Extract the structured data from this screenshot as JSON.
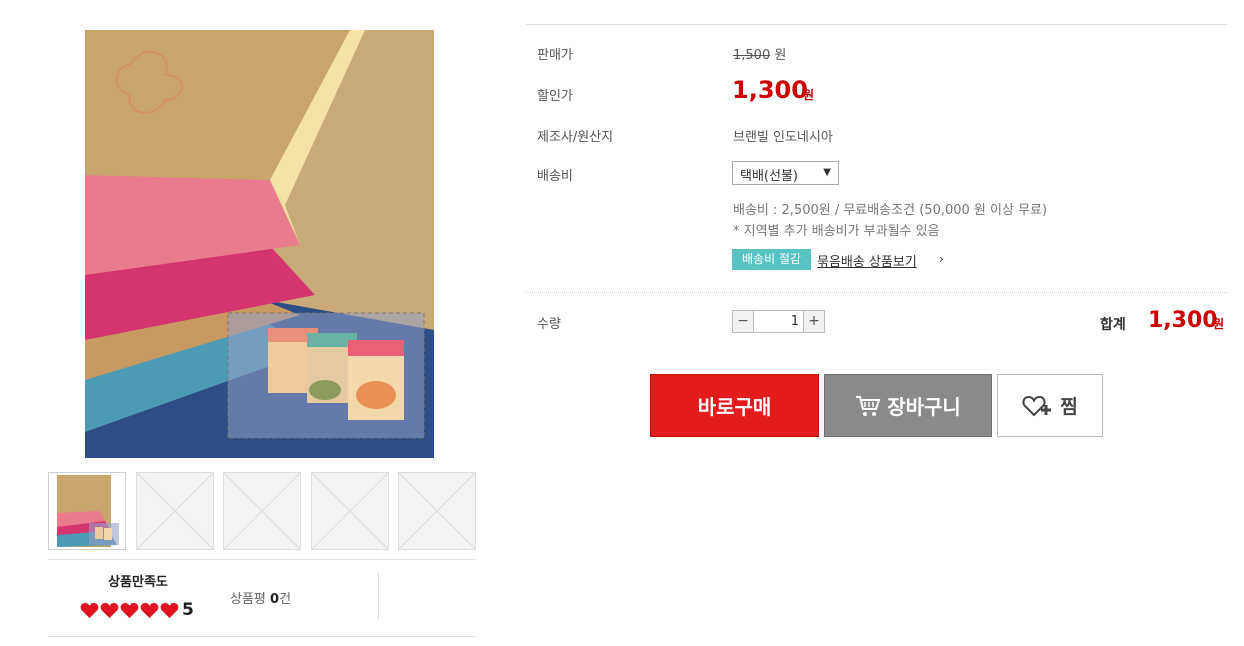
{
  "product": {
    "price_label": "판매가",
    "original_price": "1,500",
    "original_unit": "원",
    "sale_label": "할인가",
    "sale_price": "1,300",
    "sale_unit": "원",
    "maker_label": "제조사/원산지",
    "maker_value": "브랜빌 인도네시아",
    "shipping_label": "배송비",
    "shipping_option": "택배(선불)",
    "shipping_note1": "배송비 : 2,500원 / 무료배송조건 (50,000 원 이상 무료)",
    "shipping_note2": "* 지역별 추가 배송비가 부과될수 있음",
    "badge": "배송비 절감",
    "bundle_link": "묶음배송 상품보기",
    "bundle_arrow": "›",
    "qty_label": "수량",
    "qty_value": "1",
    "qty_minus": "−",
    "qty_plus": "+",
    "total_label": "합계",
    "total_price": "1,300",
    "total_unit": "원"
  },
  "buttons": {
    "buy": "바로구매",
    "cart": "장바구니",
    "wish": "찜"
  },
  "review": {
    "satisfaction_title": "상품만족도",
    "satisfaction_score": "5",
    "hearts_filled": 5,
    "review_label": "상품평",
    "review_count": "0",
    "review_unit": "건"
  },
  "thumbnails": {
    "count": 5,
    "active_index": 0
  },
  "colors": {
    "accent_red": "#cc0000",
    "buy_red": "#e21b1b",
    "cart_gray": "#8a8a8a",
    "badge_teal": "#58c3c3"
  },
  "icons": [
    "cart-icon",
    "heart-plus-icon",
    "heart-icon"
  ]
}
